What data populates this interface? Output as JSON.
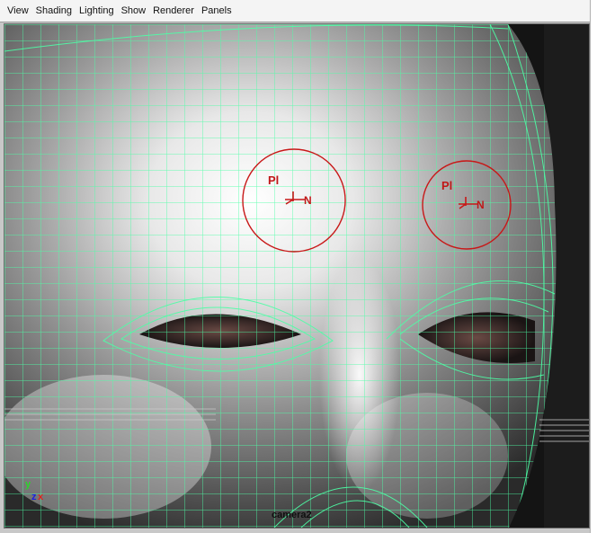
{
  "menu": [
    "View",
    "Shading",
    "Lighting",
    "Show",
    "Renderer",
    "Panels"
  ],
  "viewport": {
    "camera_label": "camera2",
    "axis": {
      "y": "y",
      "z": "z",
      "x": "x"
    },
    "manipulators": [
      {
        "pl": "Pl",
        "n": "N"
      },
      {
        "pl": "Pl",
        "n": "N"
      }
    ]
  },
  "colors": {
    "wireframe": "#4dffa6",
    "manipulator": "#c81818",
    "background": "#111111"
  }
}
